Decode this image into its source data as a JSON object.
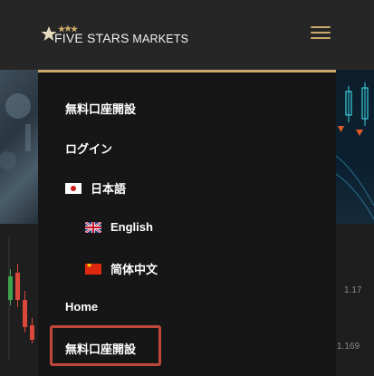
{
  "header": {
    "logo_text_small": "FIVE STARS",
    "logo_text_rest": "MARKETS",
    "logo_icon": "five-stars-logo",
    "menu_icon": "hamburger-icon"
  },
  "menu": {
    "items": [
      {
        "label": "無料口座開設",
        "icon": null
      },
      {
        "label": "ログイン",
        "icon": null
      },
      {
        "label": "日本語",
        "icon": "japan-flag-icon"
      },
      {
        "label": "English",
        "icon": "uk-flag-icon"
      },
      {
        "label": "简体中文",
        "icon": "china-flag-icon"
      },
      {
        "label": "Home",
        "icon": null
      },
      {
        "label": "無料口座開設",
        "icon": null
      }
    ]
  },
  "background": {
    "price_1": "1.17",
    "price_2": "1.169"
  },
  "colors": {
    "accent_gold": "#c9a96a",
    "highlight_red": "#c0483a",
    "menu_bg": "#161616",
    "header_bg": "#262626"
  }
}
